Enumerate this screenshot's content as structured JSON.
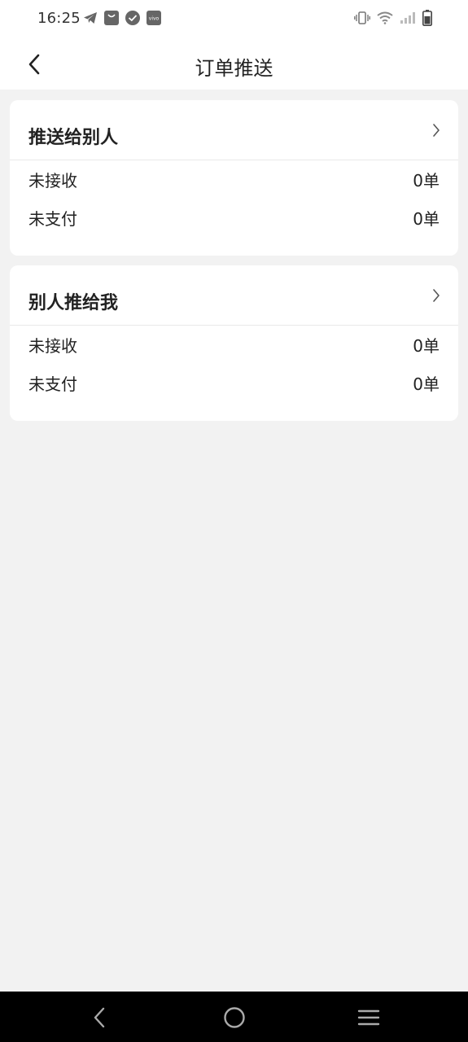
{
  "status_bar": {
    "time": "16:25",
    "left_icons": [
      "telegram-icon",
      "bag-icon",
      "check-circle-icon",
      "vivo-icon"
    ],
    "vivo_label": "vivo",
    "right_icons": [
      "vibrate-icon",
      "wifi-icon",
      "signal-icon",
      "battery-icon"
    ]
  },
  "header": {
    "title": "订单推送",
    "back_icon": "chevron-left-icon"
  },
  "sections": [
    {
      "title": "推送给别人",
      "rows": [
        {
          "label": "未接收",
          "value": "0单"
        },
        {
          "label": "未支付",
          "value": "0单"
        }
      ]
    },
    {
      "title": "别人推给我",
      "rows": [
        {
          "label": "未接收",
          "value": "0单"
        },
        {
          "label": "未支付",
          "value": "0单"
        }
      ]
    }
  ],
  "nav_bar": {
    "buttons": [
      "back-icon",
      "home-icon",
      "menu-icon"
    ]
  },
  "colors": {
    "background": "#f2f2f2",
    "card": "#ffffff",
    "text": "#222222",
    "nav_bar": "#000000"
  }
}
